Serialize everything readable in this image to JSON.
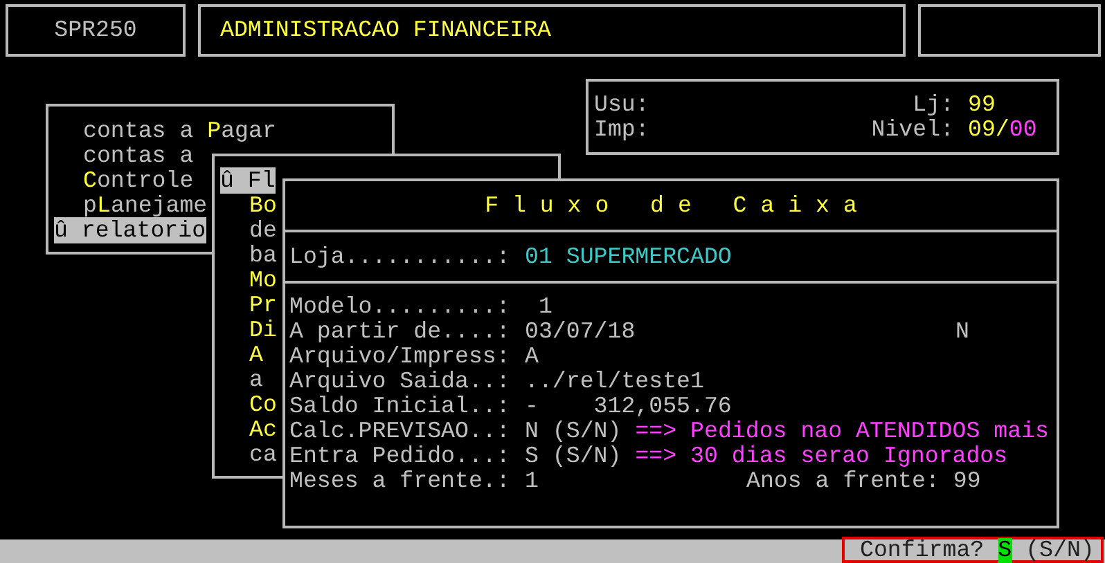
{
  "header": {
    "program": "SPR250",
    "title": "ADMINISTRACAO FINANCEIRA"
  },
  "session": {
    "user_label": "Usu:",
    "printer_label": "Imp:",
    "store_label": "Lj:",
    "store": "99",
    "nivel_label": "Nivel:",
    "nivel_main": "09/",
    "nivel_sub": "00"
  },
  "main_menu": {
    "items": [
      {
        "selected": false,
        "segments": [
          {
            "text": "contas a ",
            "hot": false
          },
          {
            "text": "P",
            "hot": true
          },
          {
            "text": "agar",
            "hot": false
          }
        ]
      },
      {
        "selected": false,
        "segments": [
          {
            "text": "contas a",
            "hot": false
          }
        ]
      },
      {
        "selected": false,
        "segments": [
          {
            "text": "C",
            "hot": true
          },
          {
            "text": "ontrole",
            "hot": false
          }
        ]
      },
      {
        "selected": false,
        "segments": [
          {
            "text": "p",
            "hot": false
          },
          {
            "text": "L",
            "hot": true
          },
          {
            "text": "anejame",
            "hot": false
          }
        ]
      },
      {
        "selected": true,
        "segments": [
          {
            "text": "û relatorio",
            "hot": false
          }
        ]
      }
    ]
  },
  "submenu": {
    "items": [
      {
        "selected": true,
        "segments": [
          {
            "text": "û Fl",
            "hot": false
          }
        ]
      },
      {
        "selected": false,
        "segments": [
          {
            "text": "Bo",
            "hot": true
          }
        ]
      },
      {
        "selected": false,
        "segments": [
          {
            "text": "de",
            "hot": false
          }
        ]
      },
      {
        "selected": false,
        "segments": [
          {
            "text": "ba",
            "hot": false
          }
        ]
      },
      {
        "selected": false,
        "segments": [
          {
            "text": "Mo",
            "hot": true
          }
        ]
      },
      {
        "selected": false,
        "segments": [
          {
            "text": "Pr",
            "hot": true
          }
        ]
      },
      {
        "selected": false,
        "segments": [
          {
            "text": "Di",
            "hot": true
          }
        ]
      },
      {
        "selected": false,
        "segments": [
          {
            "text": "A",
            "hot": true
          }
        ]
      },
      {
        "selected": false,
        "segments": [
          {
            "text": "a",
            "hot": false
          }
        ]
      },
      {
        "selected": false,
        "segments": [
          {
            "text": "Co",
            "hot": true
          }
        ]
      },
      {
        "selected": false,
        "segments": [
          {
            "text": "Ac",
            "hot": true
          }
        ]
      },
      {
        "selected": false,
        "segments": [
          {
            "text": "ca",
            "hot": false
          }
        ]
      }
    ]
  },
  "dialog": {
    "title": "F l u x o   d e   C a i x a",
    "store_label": "Loja...........:",
    "store_value": "01 SUPERMERCADO",
    "fields": [
      {
        "label": "Modelo.........:",
        "value": " 1"
      },
      {
        "label": "A partir de....:",
        "value": "03/07/18",
        "flag": "N"
      },
      {
        "label": "Arquivo/Impress:",
        "value": "A"
      },
      {
        "label": "Arquivo Saida..:",
        "value": "../rel/teste1"
      },
      {
        "label": "Saldo Inicial..:",
        "value": "-    312,055.76"
      },
      {
        "label": "Calc.PREVISAO..:",
        "value": "N (S/N)",
        "note": "==> Pedidos nao ATENDIDOS mais"
      },
      {
        "label": "Entra Pedido...:",
        "value": "S (S/N)",
        "note": "==> 30 dias serao Ignorados"
      },
      {
        "label": "Meses a frente.:",
        "value": "1",
        "aside": {
          "label": "Anos a frente:",
          "value": "99"
        }
      }
    ]
  },
  "status_bar": {
    "prompt": "Confirma?",
    "answer": "S",
    "options": "(S/N)"
  }
}
